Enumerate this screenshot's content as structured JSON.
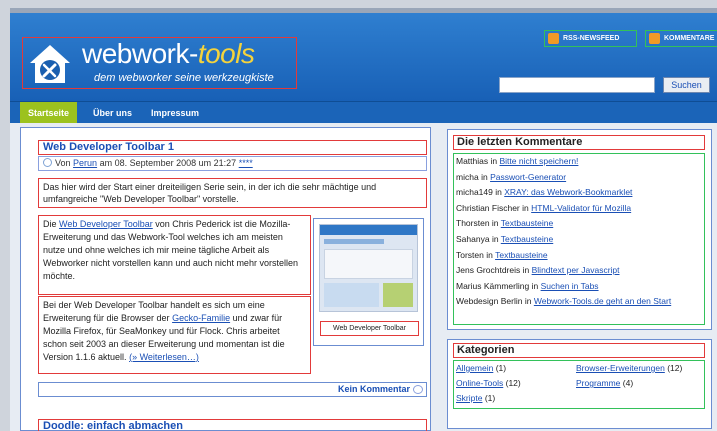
{
  "site": {
    "title_main": "webwork-",
    "title_accent": "tools",
    "tagline": "dem webworker seine werkzeugkiste"
  },
  "feeds": {
    "rss": "RSS-NEWSFEED",
    "comments": "KOMMENTARE"
  },
  "search": {
    "value": "",
    "button": "Suchen"
  },
  "nav": [
    "Startseite",
    "Über uns",
    "Impressum"
  ],
  "post": {
    "title": "Web Developer Toolbar 1",
    "meta_prefix": "Von",
    "author": "Perun",
    "meta_date": "am 08. September 2008 um 21:27",
    "meta_link": "****",
    "para1": "Das hier wird der Start einer dreiteiligen Serie sein, in der ich die sehr mächtige und umfangreiche \"Web Developer Toolbar\" vorstelle.",
    "para2_link": "Web Developer Toolbar",
    "para2_prefix": "Die",
    "para2_rest": "von Chris Pederick ist die Mozilla-Erweiterung und das Webwork-Tool welches ich am meisten nutze und ohne welches ich mir meine tägliche Arbeit als Webworker nicht vorstellen kann und auch nicht mehr vorstellen möchte.",
    "para3_start": "Bei der Web Developer Toolbar handelt es sich um eine Erweiterung für die Browser der",
    "para3_link": "Gecko-Familie",
    "para3_rest": "und zwar für Mozilla Firefox, für SeaMonkey und für Flock. Chris arbeitet schon seit 2003 an dieser Erweiterung und momentan ist die Version 1.1.6 aktuell.",
    "read_more": "(» Weiterlesen…)",
    "thumb_caption": "Web Developer Toolbar",
    "comment_count": "Kein Kommentar"
  },
  "post2": {
    "title": "Doodle: einfach abmachen"
  },
  "sidebar": {
    "comments_title": "Die letzten Kommentare",
    "comments": [
      {
        "author": "Matthias",
        "target": "Bitte nicht speichern!"
      },
      {
        "author": "micha",
        "target": "Passwort-Generator"
      },
      {
        "author": "micha149",
        "target": "XRAY: das Webwork-Bookmarklet"
      },
      {
        "author": "Christian Fischer",
        "target": "HTML-Validator für Mozilla"
      },
      {
        "author": "Thorsten",
        "target": "Textbausteine"
      },
      {
        "author": "Sahanya",
        "target": "Textbausteine"
      },
      {
        "author": "Torsten",
        "target": "Textbausteine"
      },
      {
        "author": "Jens Grochtdreis",
        "target": "Blindtext per Javascript"
      },
      {
        "author": "Marius Kämmerling",
        "target": "Suchen in Tabs"
      },
      {
        "author": "Webdesign Berlin",
        "target": "Webwork-Tools.de geht an den Start"
      }
    ],
    "in_word": "in",
    "categories_title": "Kategorien",
    "categories": [
      {
        "name": "Allgemein",
        "count": "(1)"
      },
      {
        "name": "Browser-Erweiterungen",
        "count": "(12)"
      },
      {
        "name": "Online-Tools",
        "count": "(12)"
      },
      {
        "name": "Programme",
        "count": "(4)"
      },
      {
        "name": "Skripte",
        "count": "(1)"
      }
    ]
  }
}
